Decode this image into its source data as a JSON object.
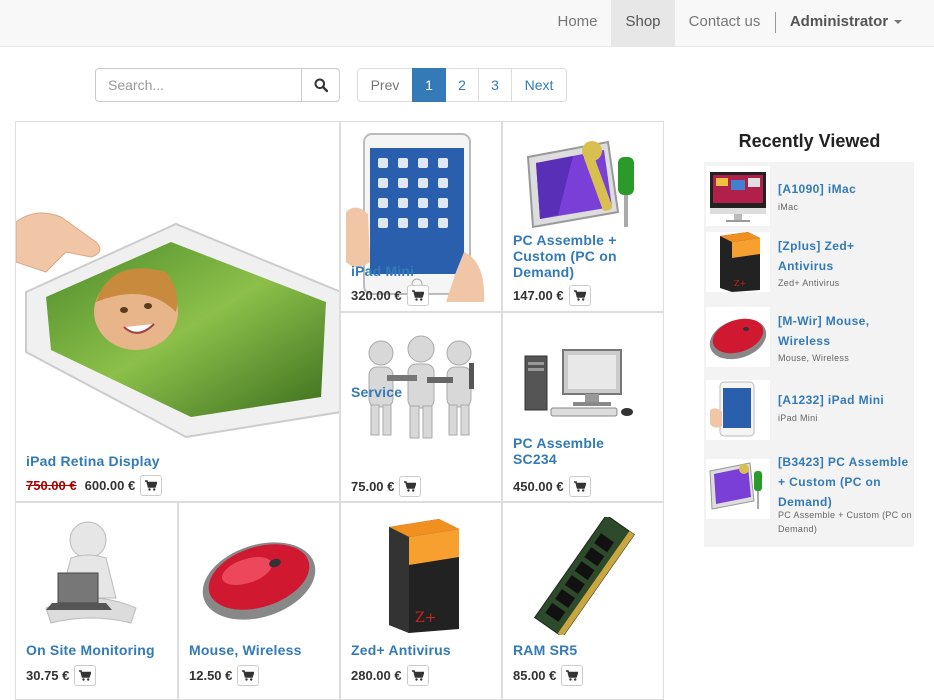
{
  "nav": {
    "home": "Home",
    "shop": "Shop",
    "contact": "Contact us",
    "admin": "Administrator"
  },
  "search": {
    "placeholder": "Search..."
  },
  "pager": {
    "prev": "Prev",
    "pages": [
      "1",
      "2",
      "3"
    ],
    "next": "Next",
    "active_page": "1"
  },
  "products": [
    {
      "name": "iPad Retina Display",
      "old_price": "750.00 €",
      "price": "600.00 €",
      "image": "ipad-retina-image"
    },
    {
      "name": "iPad Mini",
      "price": "320.00 €",
      "image": "ipad-mini-image"
    },
    {
      "name": "PC Assemble + Custom (PC on Demand)",
      "price": "147.00 €",
      "image": "pc-custom-image"
    },
    {
      "name": "Service",
      "price": "75.00 €",
      "image": "service-image"
    },
    {
      "name": "PC Assemble SC234",
      "price": "450.00 €",
      "image": "pc-sc234-image"
    },
    {
      "name": "On Site Monitoring",
      "price": "30.75 €",
      "image": "monitoring-image"
    },
    {
      "name": "Mouse, Wireless",
      "price": "12.50 €",
      "image": "mouse-image"
    },
    {
      "name": "Zed+ Antivirus",
      "price": "280.00 €",
      "image": "antivirus-image"
    },
    {
      "name": "RAM SR5",
      "price": "85.00 €",
      "image": "ram-image"
    }
  ],
  "recently_viewed": {
    "title": "Recently Viewed",
    "items": [
      {
        "name": "[A1090] iMac",
        "desc": "iMac"
      },
      {
        "name": "[Zplus] Zed+ Antivirus",
        "desc": "Zed+ Antivirus"
      },
      {
        "name": "[M-Wir] Mouse, Wireless",
        "desc": "Mouse, Wireless"
      },
      {
        "name": "[A1232] iPad Mini",
        "desc": "iPad Mini"
      },
      {
        "name": "[B3423] PC Assemble + Custom (PC on Demand)",
        "desc": "PC Assemble + Custom (PC on Demand)"
      }
    ]
  },
  "colors": {
    "link": "#337ab7",
    "active_page": "#337ab7",
    "old_price": "#aa0000",
    "nav_bg": "#f8f8f8"
  },
  "icons": {
    "search": "search-icon",
    "cart": "cart-icon",
    "caret": "caret-down-icon"
  }
}
